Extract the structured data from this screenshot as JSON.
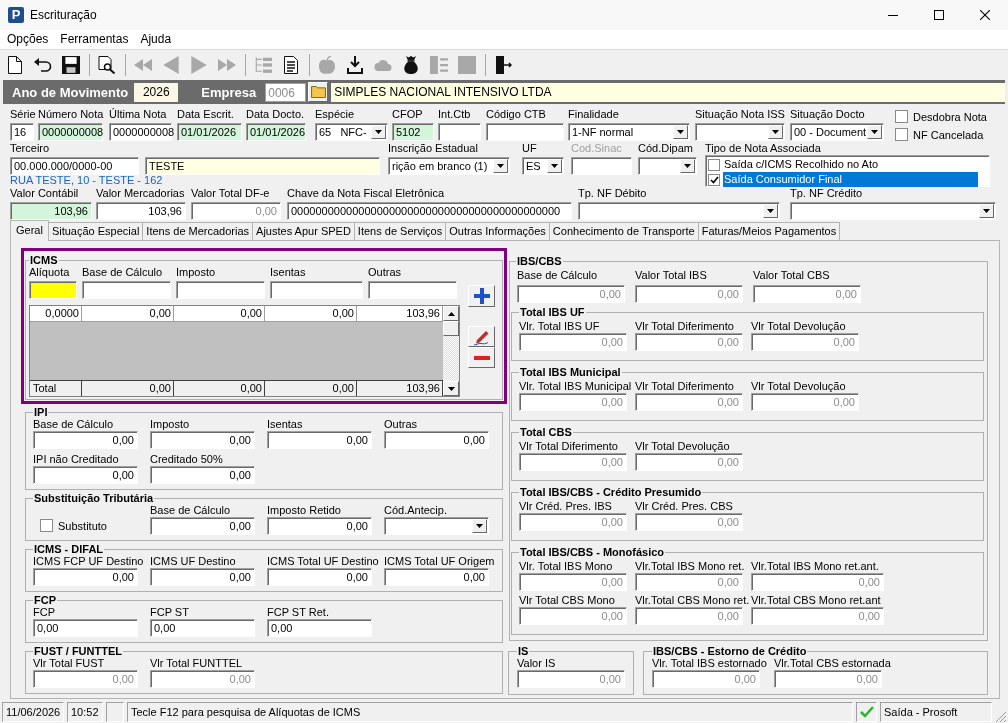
{
  "window": {
    "title": "Escrituração",
    "icon_text": "P"
  },
  "menu": [
    {
      "label": "Opções"
    },
    {
      "label": "Ferramentas"
    },
    {
      "label": "Ajuda"
    }
  ],
  "toolbar": [
    {
      "kind": "new",
      "disabled": false
    },
    {
      "kind": "undo",
      "disabled": false
    },
    {
      "kind": "save",
      "disabled": false
    },
    {
      "kind": "separator"
    },
    {
      "kind": "preview",
      "disabled": false
    },
    {
      "kind": "separator"
    },
    {
      "kind": "first",
      "disabled": true
    },
    {
      "kind": "previous",
      "disabled": true
    },
    {
      "kind": "next",
      "disabled": true
    },
    {
      "kind": "last",
      "disabled": true
    },
    {
      "kind": "separator"
    },
    {
      "kind": "tree",
      "disabled": true
    },
    {
      "kind": "report",
      "disabled": false
    },
    {
      "kind": "separator"
    },
    {
      "kind": "apple",
      "disabled": true
    },
    {
      "kind": "download",
      "disabled": false
    },
    {
      "kind": "cloud",
      "disabled": true
    },
    {
      "kind": "bag",
      "disabled": false
    },
    {
      "kind": "columns",
      "disabled": true
    },
    {
      "kind": "square",
      "disabled": true
    },
    {
      "kind": "separator"
    },
    {
      "kind": "exit",
      "disabled": false
    }
  ],
  "header": {
    "year_label": "Ano de Movimento",
    "year": "2026",
    "company_label": "Empresa",
    "company_code": "0006",
    "company_name": "SIMPLES NACIONAL INTENSIVO LTDA"
  },
  "document": {
    "row_1": [
      {
        "label": "Série",
        "value": "16",
        "kind": "text"
      },
      {
        "label": "Número Nota",
        "value": "0000000008",
        "kind": "text",
        "color": "#d4f5dc"
      },
      {
        "label": "Última Nota",
        "value": "0000000008",
        "kind": "text"
      },
      {
        "label": "Data Escrit.",
        "value": "01/01/2026",
        "kind": "text",
        "color": "#d4f5dc"
      },
      {
        "label": "Data Docto.",
        "value": "01/01/2026",
        "kind": "text",
        "color": "#d4f5dc"
      },
      {
        "label": "Espécie",
        "value": "65   NFC-",
        "kind": "combo"
      },
      {
        "label": "CFOP",
        "value": "5102",
        "kind": "text",
        "color": "#d4f5dc"
      },
      {
        "label": "Int.Ctb",
        "kind": "text"
      },
      {
        "label": "Código CTB",
        "kind": "text"
      },
      {
        "label": "Finalidade",
        "value": "1-NF normal",
        "kind": "combo"
      },
      {
        "label": "Situação Nota ISS",
        "kind": "combo"
      },
      {
        "label": "Situação Docto",
        "value": "00 - Document",
        "kind": "combo"
      }
    ],
    "flags": [
      {
        "label": "Desdobra Nota",
        "checked": false
      },
      {
        "label": "NF Cancelada",
        "checked": false
      }
    ],
    "row_2": [
      {
        "label": "Terceiro",
        "value": "00.000.000/0000-00",
        "kind": "text",
        "disabled": false
      },
      {
        "value": "TESTE",
        "kind": "text",
        "color": "#ffffe1",
        "disabled": false
      },
      {
        "label": "Inscrição Estadual",
        "value": "rição em branco (1)",
        "kind": "combo",
        "disabled": false
      },
      {
        "label": "UF",
        "value": "ES",
        "kind": "combo",
        "disabled": false
      },
      {
        "label": "Cod.Sinac",
        "kind": "text",
        "disabled": true
      },
      {
        "label": "Cód.Dipam",
        "kind": "combo",
        "disabled": false
      }
    ],
    "address": "RUA TESTE, 10 - TESTE - 162",
    "note_type": {
      "label": "Tipo de Nota Associada",
      "options": [
        {
          "label": "Saída c/ICMS Recolhido no Ato",
          "checked": false,
          "selected": false
        },
        {
          "label": "Saída Consumidor Final",
          "checked": true,
          "selected": true
        }
      ]
    },
    "row_3": [
      {
        "label": "Valor Contábil",
        "value": "103,96",
        "kind": "number",
        "color": "#d4f5dc",
        "readonly": false
      },
      {
        "label": "Valor Mercadorias",
        "value": "103,96",
        "kind": "number",
        "readonly": false
      },
      {
        "label": "Valor Total DF-e",
        "value": "0,00",
        "kind": "number",
        "readonly": true
      },
      {
        "label": "Chave da Nota Fiscal Eletrônica",
        "value": "00000000000000000000000000000000000000000000",
        "kind": "text",
        "readonly": false
      },
      {
        "label": "Tp. NF Débito",
        "kind": "combo",
        "readonly": false
      },
      {
        "label": "Tp. NF Crédito",
        "kind": "combo",
        "readonly": false
      }
    ]
  },
  "tabs": [
    {
      "label": "Geral",
      "selected": true
    },
    {
      "label": "Situação Especial",
      "selected": false
    },
    {
      "label": "Itens de Mercadorias",
      "selected": false
    },
    {
      "label": "Ajustes Apur SPED",
      "selected": false
    },
    {
      "label": "Itens de Serviços",
      "selected": false
    },
    {
      "label": "Outras Informações",
      "selected": false
    },
    {
      "label": "Conhecimento de Transporte",
      "selected": false
    },
    {
      "label": "Faturas/Meios Pagamentos",
      "selected": false
    }
  ],
  "icms": {
    "title": "ICMS",
    "highlighted": true,
    "columns": [
      "Alíquota",
      "Base de Cálculo",
      "Imposto",
      "Isentas",
      "Outras"
    ],
    "entries": [
      {
        "focused": true
      },
      {
        "focused": false
      },
      {
        "focused": false
      },
      {
        "focused": false
      },
      {
        "focused": false
      }
    ],
    "rows": [
      [
        "0,0000",
        "0,00",
        "0,00",
        "0,00",
        "103,96"
      ]
    ],
    "total": [
      "Total",
      "0,00",
      "0,00",
      "0,00",
      "103,96"
    ],
    "buttons": [
      {
        "kind": "add"
      },
      {
        "kind": "edit"
      },
      {
        "kind": "remove"
      }
    ]
  },
  "left_groups": [
    {
      "title": "IPI",
      "readonly": false,
      "rows": [
        [
          {
            "label": "Base de Cálculo",
            "value": "0,00",
            "kind": "number"
          },
          {
            "label": "Imposto",
            "value": "0,00",
            "kind": "number"
          },
          {
            "label": "Isentas",
            "value": "0,00",
            "kind": "number"
          },
          {
            "label": "Outras",
            "value": "0,00",
            "kind": "number"
          }
        ],
        [
          {
            "label": "IPI não Creditado",
            "value": "0,00",
            "kind": "number"
          },
          {
            "label": "Creditado 50%",
            "value": "0,00",
            "kind": "number"
          }
        ]
      ]
    },
    {
      "title": "Substituição Tributária",
      "readonly": false,
      "rows": [
        [
          {
            "label": "Substituto",
            "kind": "checkbox",
            "checked": false
          },
          {
            "label": "Base de Cálculo",
            "value": "0,00",
            "kind": "number"
          },
          {
            "label": "Imposto Retido",
            "value": "0,00",
            "kind": "number"
          },
          {
            "label": "Cód.Antecip.",
            "kind": "combo"
          }
        ]
      ]
    },
    {
      "title": "ICMS - DIFAL",
      "readonly": false,
      "rows": [
        [
          {
            "label": "ICMS FCP UF Destino",
            "value": "0,00",
            "kind": "number"
          },
          {
            "label": "ICMS UF Destino",
            "value": "0,00",
            "kind": "number"
          },
          {
            "label": "ICMS Total UF Destino",
            "value": "0,00",
            "kind": "number"
          },
          {
            "label": "ICMS Total UF Origem",
            "value": "0,00",
            "kind": "number"
          }
        ]
      ]
    },
    {
      "title": "FCP",
      "readonly": false,
      "rows": [
        [
          {
            "label": "FCP",
            "value": "0,00",
            "kind": "text"
          },
          {
            "label": "FCP ST",
            "value": "0,00",
            "kind": "text"
          },
          {
            "label": "FCP ST Ret.",
            "value": "0,00",
            "kind": "text"
          }
        ]
      ]
    },
    {
      "title": "FUST / FUNTTEL",
      "readonly": true,
      "rows": [
        [
          {
            "label": "Vlr Total FUST",
            "value": "0,00",
            "kind": "number"
          },
          {
            "label": "Vlr Total FUNTTEL",
            "value": "0,00",
            "kind": "number"
          }
        ]
      ]
    }
  ],
  "ibs_cbs": {
    "title": "IBS/CBS",
    "readonly": true,
    "rows": [
      [
        {
          "label": "Base de Cálculo",
          "value": "0,00",
          "kind": "number"
        },
        {
          "label": "Valor Total IBS",
          "value": "0,00",
          "kind": "number"
        },
        {
          "label": "Valor Total CBS",
          "value": "0,00",
          "kind": "number"
        }
      ]
    ],
    "subgroups": [
      {
        "title": "Total IBS UF",
        "readonly": true,
        "rows": [
          [
            {
              "label": "Vlr. Total IBS UF",
              "value": "0,00",
              "kind": "number"
            },
            {
              "label": "Vlr Total Diferimento",
              "value": "0,00",
              "kind": "number"
            },
            {
              "label": "Vlr Total Devolução",
              "value": "0,00",
              "kind": "number"
            }
          ]
        ]
      },
      {
        "title": "Total IBS Municipal",
        "readonly": true,
        "rows": [
          [
            {
              "label": "Vlr. Total IBS Municipal",
              "value": "0,00",
              "kind": "number"
            },
            {
              "label": "Vlr Total Diferimento",
              "value": "0,00",
              "kind": "number"
            },
            {
              "label": "Vlr Total Devolução",
              "value": "0,00",
              "kind": "number"
            }
          ]
        ]
      },
      {
        "title": "Total CBS",
        "readonly": true,
        "rows": [
          [
            {
              "label": "Vlr Total Diferimento",
              "value": "0,00",
              "kind": "number"
            },
            {
              "label": "Vlr Total Devolução",
              "value": "0,00",
              "kind": "number"
            }
          ]
        ]
      },
      {
        "title": "Total IBS/CBS - Crédito Presumido",
        "readonly": true,
        "rows": [
          [
            {
              "label": "Vlr Créd. Pres. IBS",
              "value": "0,00",
              "kind": "number"
            },
            {
              "label": "Vlr Créd. Pres. CBS",
              "value": "0,00",
              "kind": "number"
            }
          ]
        ]
      },
      {
        "title": "Total IBS/CBS - Monofásico",
        "readonly": true,
        "rows": [
          [
            {
              "label": "Vlr. Total IBS Mono",
              "value": "0,00",
              "kind": "number"
            },
            {
              "label": "Vlr.Total IBS Mono ret.",
              "value": "0,00",
              "kind": "number"
            },
            {
              "label": "Vlr.Total IBS Mono ret.ant.",
              "value": "0,00",
              "kind": "number"
            }
          ],
          [
            {
              "label": "Vlr Total CBS Mono",
              "value": "0,00",
              "kind": "number"
            },
            {
              "label": "Vlr.Total CBS Mono ret.",
              "value": "0,00",
              "kind": "number"
            },
            {
              "label": "Vlr.Total CBS Mono ret.ant",
              "value": "0,00",
              "kind": "number"
            }
          ]
        ]
      }
    ]
  },
  "bottom_groups": [
    {
      "title": "IS",
      "readonly": true,
      "rows": [
        [
          {
            "label": "Valor IS",
            "value": "0,00",
            "kind": "number"
          }
        ]
      ]
    },
    {
      "title": "IBS/CBS - Estorno de Crédito",
      "readonly": true,
      "rows": [
        [
          {
            "label": "Vlr. Total IBS estornado",
            "value": "0,00",
            "kind": "number"
          },
          {
            "label": "Vlr.Total CBS estornada",
            "value": "0,00",
            "kind": "number"
          }
        ]
      ]
    }
  ],
  "status_bar": {
    "date": "11/06/2026",
    "time": "10:52",
    "message": "Tecle F12 para pesquisa de Alíquotas de ICMS",
    "status": "Saída - Prosoft"
  }
}
